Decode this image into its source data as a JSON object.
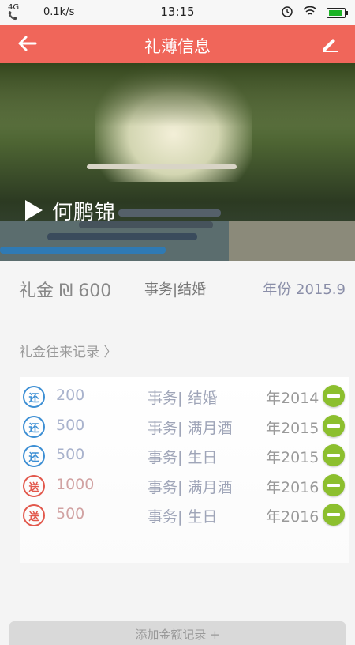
{
  "status_bar": {
    "network": "4G",
    "speed": "0.1k/s",
    "time": "13:15"
  },
  "app_bar": {
    "title": "礼薄信息"
  },
  "hero": {
    "name": "何鹏锦"
  },
  "info": {
    "amount_label": "礼金 ₪ 600",
    "event": "事务|结婚",
    "year": "年份 2015.9"
  },
  "section": {
    "title": "礼金往来记录 〉"
  },
  "records": [
    {
      "type": "还",
      "amount": "200",
      "event": "事务| 结婚",
      "year": "年2014"
    },
    {
      "type": "还",
      "amount": "500",
      "event": "事务| 满月酒",
      "year": "年2015"
    },
    {
      "type": "还",
      "amount": "500",
      "event": "事务| 生日",
      "year": "年2015"
    },
    {
      "type": "送",
      "amount": "1000",
      "event": "事务| 满月酒",
      "year": "年2016"
    },
    {
      "type": "送",
      "amount": "500",
      "event": "事务| 生日",
      "year": "年2016"
    }
  ],
  "footer": {
    "add_label": "添加金额记录 +"
  },
  "colors": {
    "accent": "#f0665a",
    "return": "#3d8fd4",
    "send": "#e2584c",
    "remove": "#8cbf2e"
  }
}
